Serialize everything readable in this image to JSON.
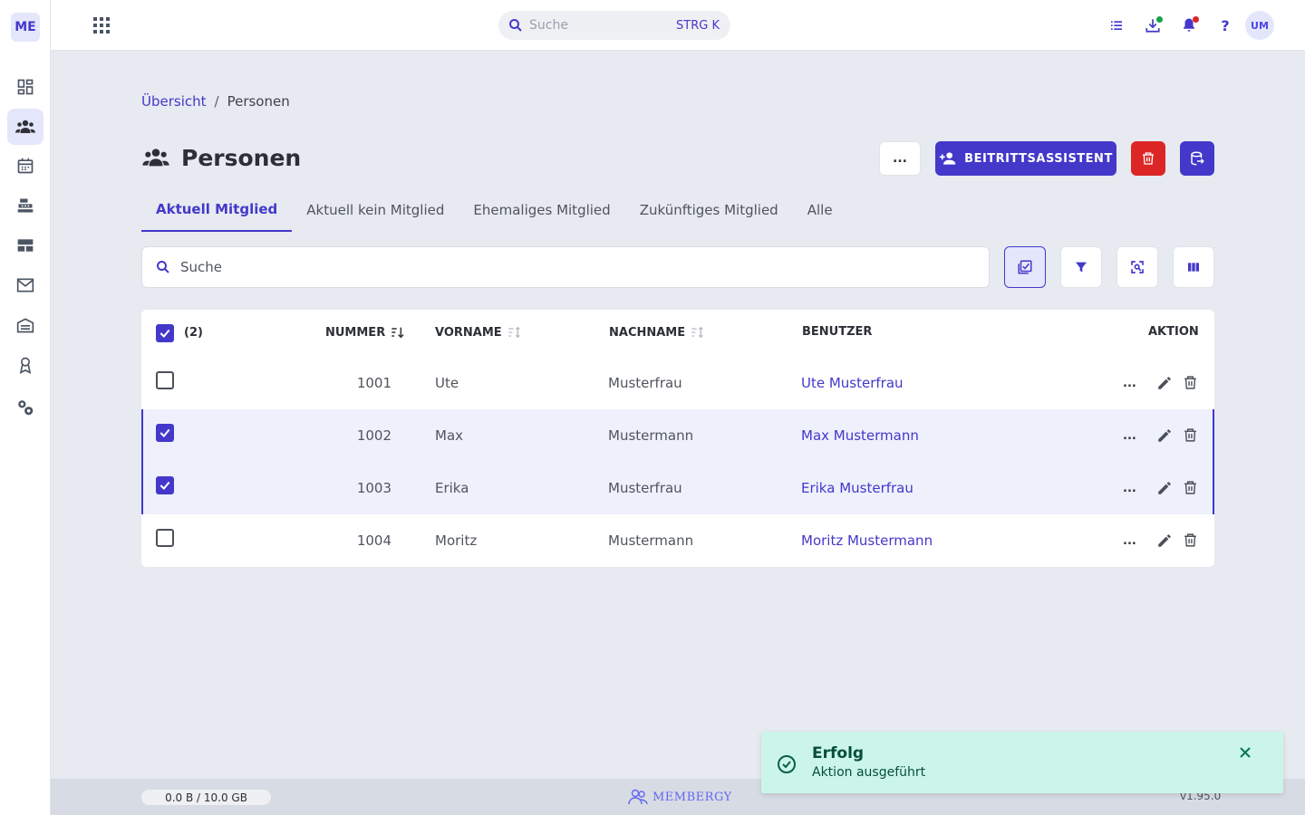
{
  "app": {
    "logo": "ME",
    "user_initials": "UM"
  },
  "colors": {
    "accent": "#4338ca",
    "danger": "#dc2626",
    "success_bg": "#ccf5e9",
    "dot_green": "#16a34a",
    "dot_red": "#dc2626"
  },
  "sidebar": {
    "items": [
      {
        "icon": "dashboard-icon"
      },
      {
        "icon": "people-icon",
        "active": true
      },
      {
        "icon": "calendar-icon"
      },
      {
        "icon": "cash-register-icon"
      },
      {
        "icon": "layout-icon"
      },
      {
        "icon": "mail-icon"
      },
      {
        "icon": "warehouse-icon"
      },
      {
        "icon": "medal-icon"
      },
      {
        "icon": "settings-icon"
      }
    ]
  },
  "topbar": {
    "search_placeholder": "Suche",
    "search_shortcut": "STRG K",
    "icons": [
      "list-icon",
      "download-icon",
      "bell-icon",
      "help-icon"
    ]
  },
  "breadcrumb": {
    "parent": "Übersicht",
    "separator": "/",
    "current": "Personen"
  },
  "header": {
    "title": "Personen",
    "more_label": "...",
    "primary_label": "BEITRITTSASSISTENT"
  },
  "tabs": [
    {
      "label": "Aktuell Mitglied",
      "active": true
    },
    {
      "label": "Aktuell kein Mitglied"
    },
    {
      "label": "Ehemaliges Mitglied"
    },
    {
      "label": "Zukünftiges Mitglied"
    },
    {
      "label": "Alle"
    }
  ],
  "list_search": {
    "placeholder": "Suche"
  },
  "table": {
    "selected_count": "(2)",
    "columns": {
      "number": "NUMMER",
      "first_name": "VORNAME",
      "last_name": "NACHNAME",
      "user": "BENUTZER",
      "action": "AKTION"
    },
    "rows": [
      {
        "number": "1001",
        "first_name": "Ute",
        "last_name": "Musterfrau",
        "user": "Ute Musterfrau",
        "checked": false
      },
      {
        "number": "1002",
        "first_name": "Max",
        "last_name": "Mustermann",
        "user": "Max Mustermann",
        "checked": true
      },
      {
        "number": "1003",
        "first_name": "Erika",
        "last_name": "Musterfrau",
        "user": "Erika Musterfrau",
        "checked": true
      },
      {
        "number": "1004",
        "first_name": "Moritz",
        "last_name": "Mustermann",
        "user": "Moritz Mustermann",
        "checked": false
      }
    ],
    "row_more_label": "..."
  },
  "footer": {
    "storage": "0.0 B / 10.0 GB",
    "brand": "MEMBERGY",
    "version": "v1.95.0"
  },
  "toast": {
    "title": "Erfolg",
    "message": "Aktion ausgeführt"
  }
}
